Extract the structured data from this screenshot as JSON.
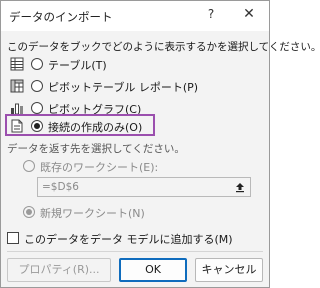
{
  "window": {
    "title": "データのインポート",
    "help": "?",
    "close": "✕"
  },
  "prompt_view": "このデータをブックでどのように表示するかを選択してください。",
  "view_options": [
    {
      "label": "テーブル(T)",
      "selected": false,
      "icon": "table-icon"
    },
    {
      "label": "ピボットテーブル レポート(P)",
      "selected": false,
      "icon": "pivot-table-icon"
    },
    {
      "label": "ピボットグラフ(C)",
      "selected": false,
      "icon": "pivot-chart-icon"
    },
    {
      "label": "接続の作成のみ(O)",
      "selected": true,
      "icon": "connection-only-icon"
    }
  ],
  "prompt_location": "データを返す先を選択してください。",
  "location_options": [
    {
      "label": "既存のワークシート(E):",
      "selected": false
    },
    {
      "label": "新規ワークシート(N)",
      "selected": true
    }
  ],
  "cell_reference": {
    "value": "=$D$6"
  },
  "data_model_checkbox": {
    "label": "このデータをデータ モデルに追加する(M)",
    "checked": false
  },
  "buttons": {
    "properties": "プロパティ(R)...",
    "ok": "OK",
    "cancel": "キャンセル"
  },
  "colors": {
    "highlight": "#9b4fae",
    "accent": "#0f6cbd"
  }
}
